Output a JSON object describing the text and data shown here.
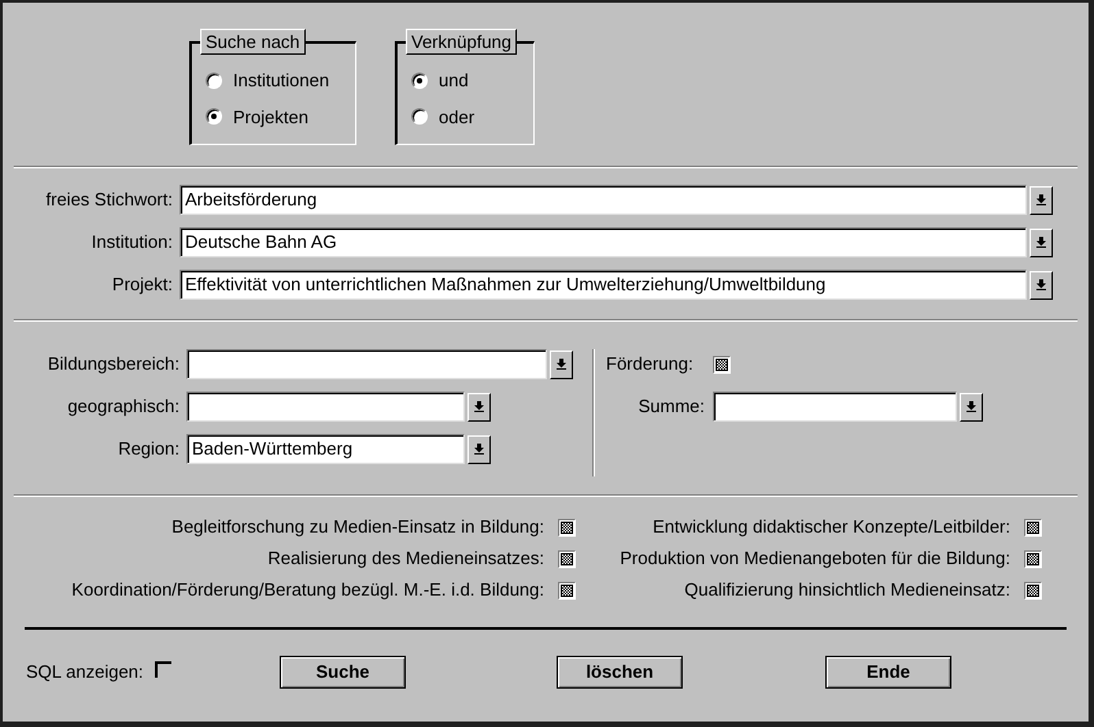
{
  "search_for": {
    "title": "Suche nach",
    "options": [
      {
        "label": "Institutionen",
        "selected": false
      },
      {
        "label": "Projekten",
        "selected": true
      }
    ]
  },
  "link": {
    "title": "Verknüpfung",
    "options": [
      {
        "label": "und",
        "selected": true
      },
      {
        "label": "oder",
        "selected": false
      }
    ]
  },
  "text_fields": [
    {
      "label": "freies Stichwort:",
      "value": "Arbeitsförderung"
    },
    {
      "label": "Institution:",
      "value": "Deutsche Bahn AG"
    },
    {
      "label": "Projekt:",
      "value": "Effektivität von unterrichtlichen Maßnahmen zur Umwelterziehung/Umweltbildung"
    }
  ],
  "filters": [
    {
      "label": "Bildungsbereich:"
    },
    {
      "label": "geographisch:"
    },
    {
      "label": "Region:",
      "value": "Baden-Württemberg"
    }
  ],
  "funding": {
    "label": "Förderung:",
    "indeterminate": true
  },
  "sum": {
    "label": "Summe:"
  },
  "categories_left": [
    {
      "label": "Begleitforschung zu Medien-Einsatz in Bildung:",
      "indeterminate": true
    },
    {
      "label": "Realisierung des Medieneinsatzes:",
      "indeterminate": true
    },
    {
      "label": "Koordination/Förderung/Beratung bezügl. M.-E. i.d. Bildung:",
      "indeterminate": true
    }
  ],
  "categories_right": [
    {
      "label": "Entwicklung didaktischer Konzepte/Leitbilder:",
      "indeterminate": true
    },
    {
      "label": "Produktion von Medienangeboten für die Bildung:",
      "indeterminate": true
    },
    {
      "label": "Qualifizierung hinsichtlich Medieneinsatz:",
      "indeterminate": true
    }
  ],
  "sql": {
    "label": "SQL anzeigen:",
    "checked": false
  },
  "buttons": [
    "Suche",
    "löschen",
    "Ende"
  ]
}
